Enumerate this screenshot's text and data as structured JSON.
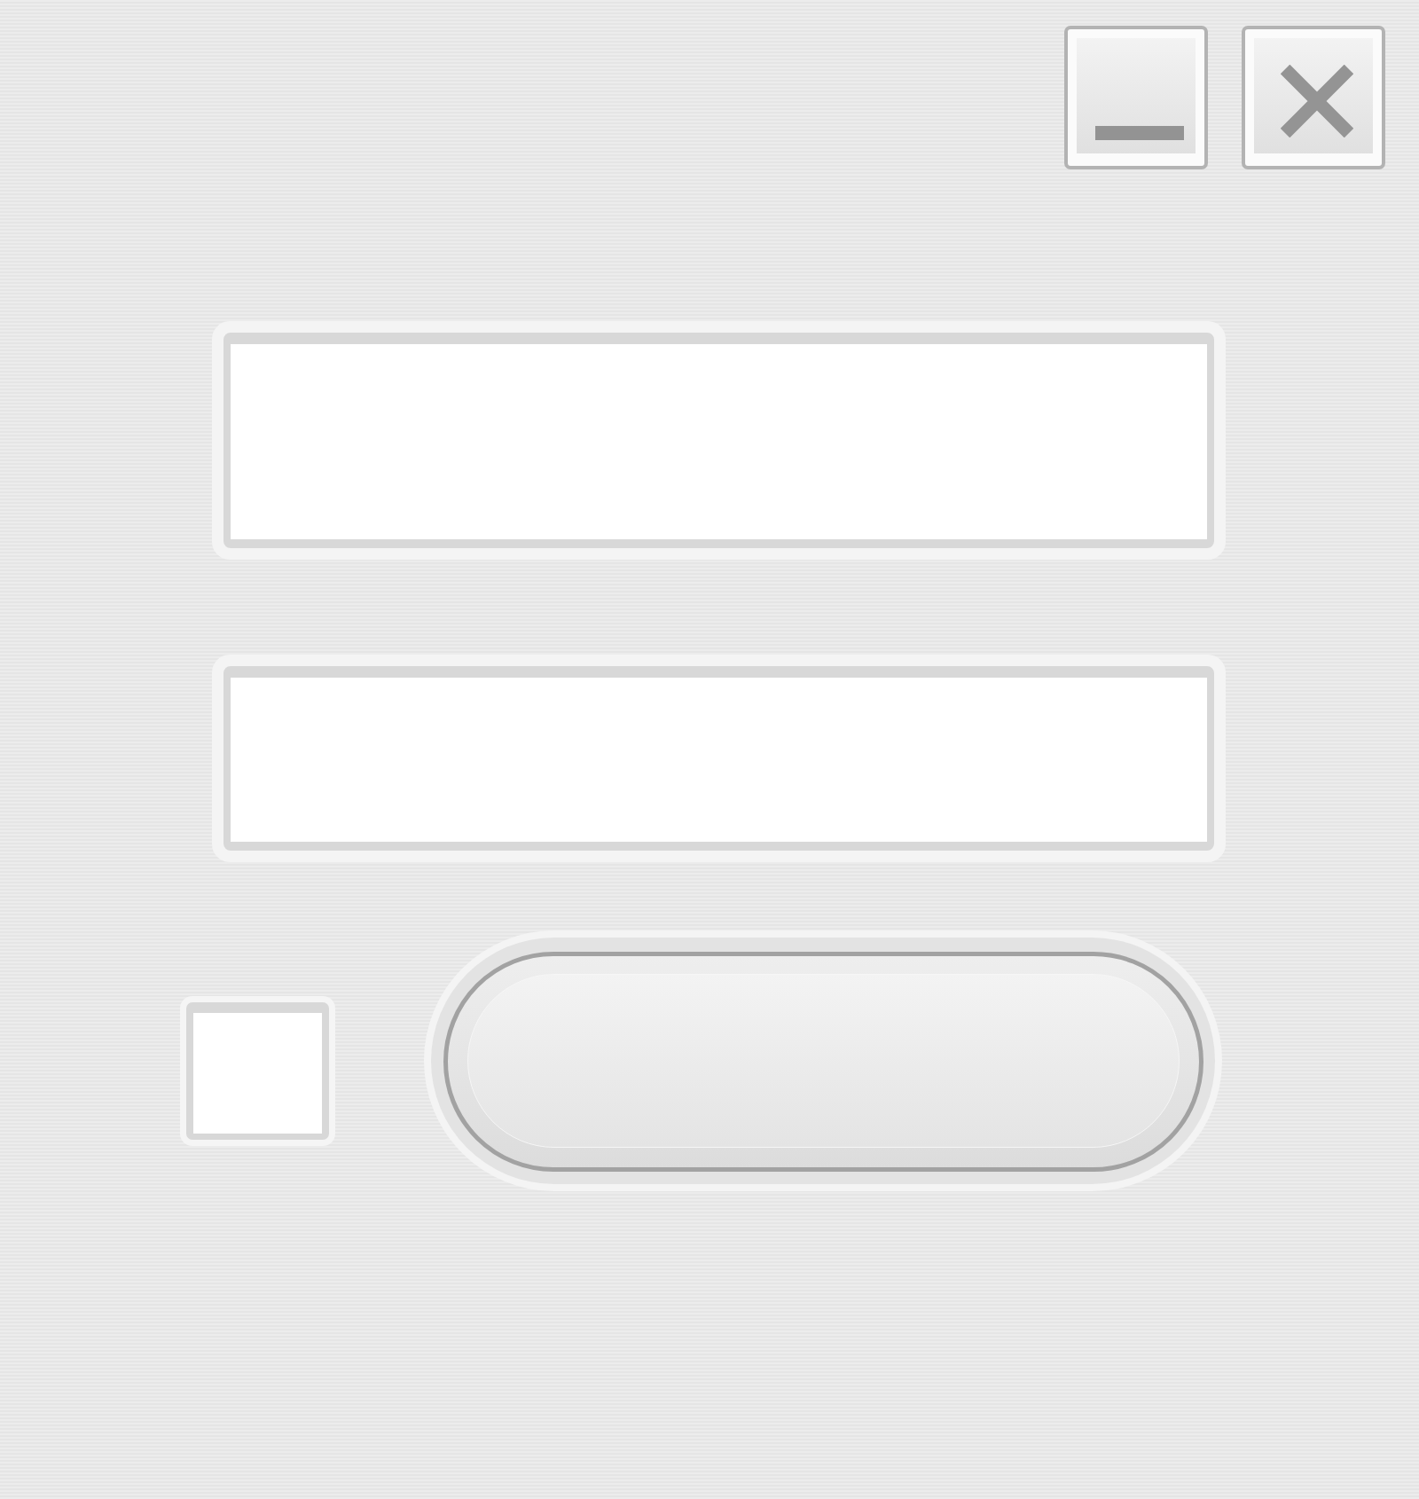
{
  "window_controls": [
    {
      "kind": "minimize"
    },
    {
      "kind": "close"
    }
  ],
  "checkbox": {
    "checked": false
  }
}
